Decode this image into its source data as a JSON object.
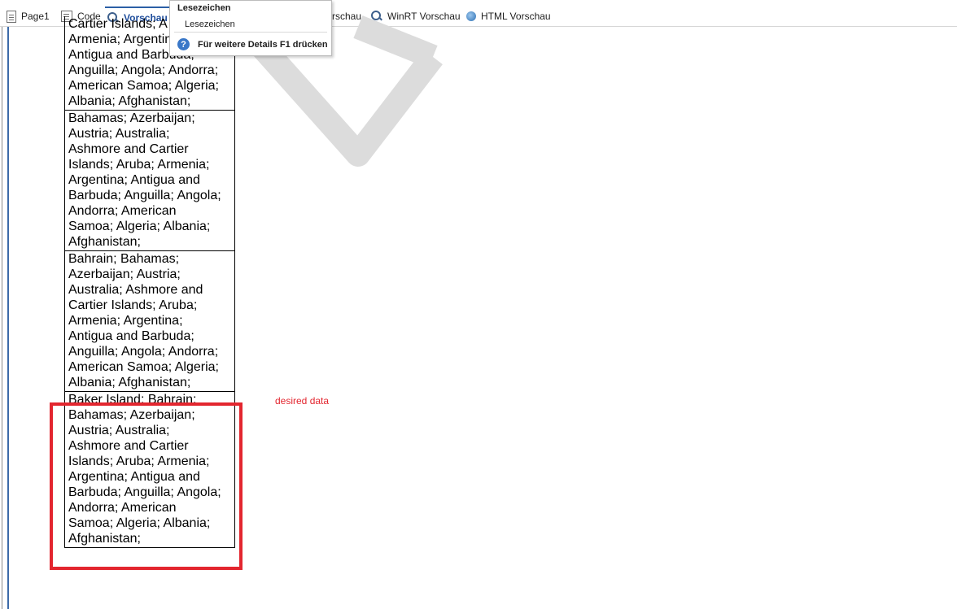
{
  "tabs": [
    {
      "label": "Page1",
      "icon": "page-icon"
    },
    {
      "label": "Code",
      "icon": "code-icon"
    },
    {
      "label": "Vorschau",
      "icon": "preview-icon",
      "active": true
    },
    {
      "label": "rschau",
      "icon": "preview-icon"
    },
    {
      "label": "WinRT Vorschau",
      "icon": "winrt-preview-icon"
    },
    {
      "label": "HTML Vorschau",
      "icon": "globe-icon"
    }
  ],
  "tooltip": {
    "title": "Lesezeichen",
    "description": "Lesezeichen",
    "help": "Für weitere Details F1 drücken",
    "help_icon": "?"
  },
  "table": {
    "rows": [
      [
        "Cartier Islands; A",
        "Armenia; Argentin",
        "Antigua and Barbuda;",
        "Anguilla; Angola; Andorra;",
        "American Samoa; Algeria;",
        "Albania; Afghanistan;"
      ],
      [
        "Bahamas; Azerbaijan;",
        "Austria; Australia;",
        "Ashmore and Cartier",
        "Islands; Aruba; Armenia;",
        "Argentina; Antigua and",
        "Barbuda; Anguilla; Angola;",
        "Andorra; American",
        "Samoa; Algeria; Albania;",
        "Afghanistan;"
      ],
      [
        "Bahrain; Bahamas;",
        "Azerbaijan; Austria;",
        "Australia; Ashmore and",
        "Cartier Islands; Aruba;",
        "Armenia; Argentina;",
        "Antigua and Barbuda;",
        "Anguilla; Angola; Andorra;",
        "American Samoa; Algeria;",
        "Albania; Afghanistan;"
      ],
      [
        "Baker Island; Bahrain;",
        "Bahamas; Azerbaijan;",
        "Austria; Australia;",
        "Ashmore and Cartier",
        "Islands; Aruba; Armenia;",
        "Argentina; Antigua and",
        "Barbuda; Anguilla; Angola;",
        "Andorra; American",
        "Samoa; Algeria; Albania;",
        "Afghanistan;"
      ]
    ]
  },
  "annotation": {
    "text": "desired data",
    "color": "#e3262f"
  },
  "colors": {
    "accent": "#2b5fa6",
    "highlight": "#e3262f",
    "watermark": "#dcdcdc"
  }
}
